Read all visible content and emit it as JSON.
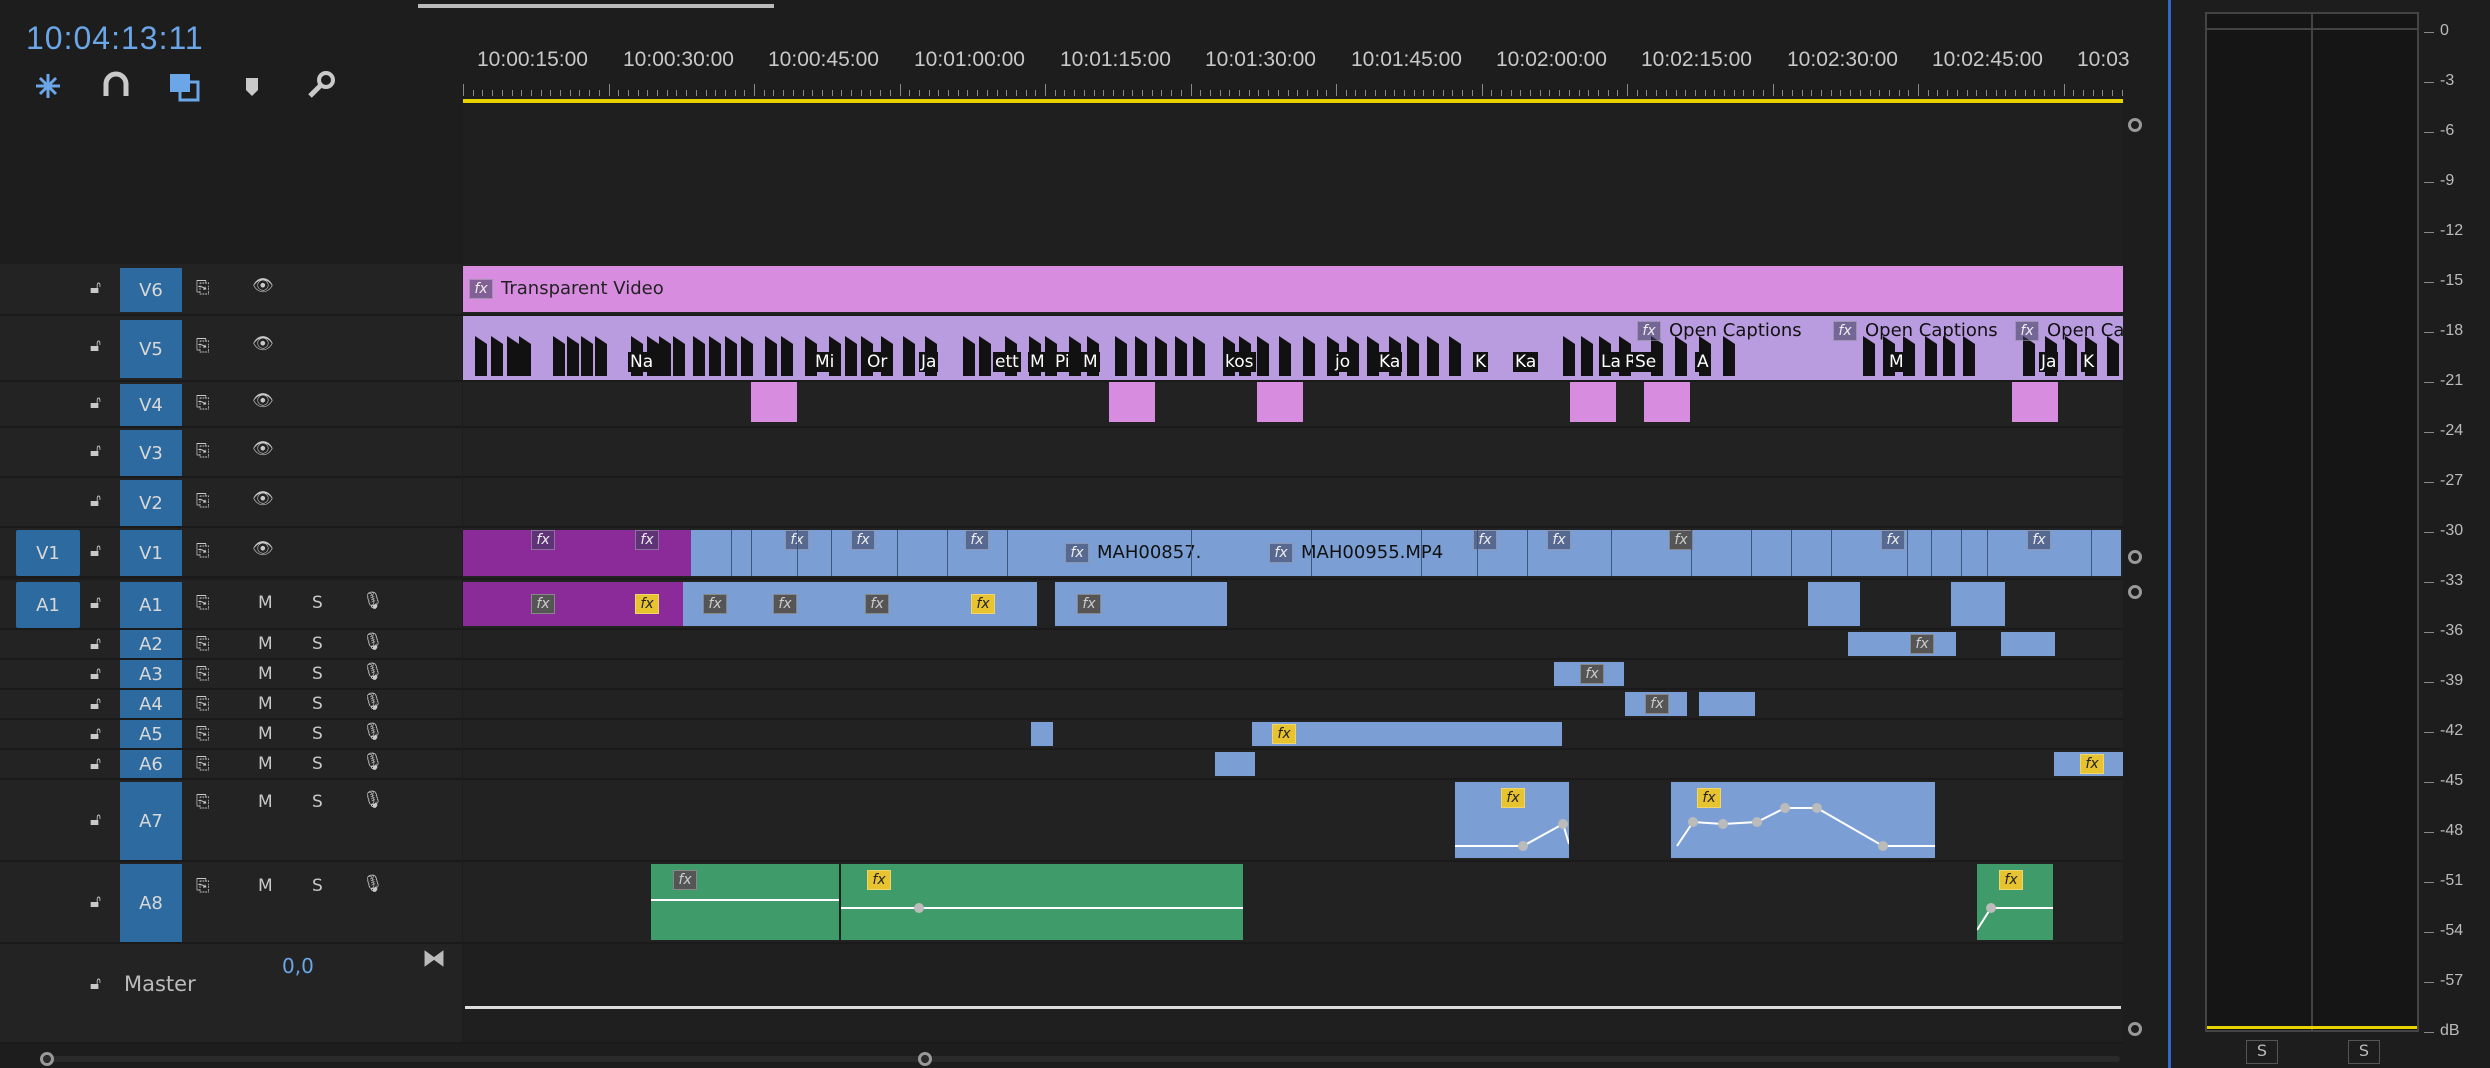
{
  "timecode": "10:04:13:11",
  "tools": [
    {
      "name": "snap-insert-icon"
    },
    {
      "name": "magnet-icon"
    },
    {
      "name": "linked-selection-icon"
    },
    {
      "name": "marker-icon"
    },
    {
      "name": "wrench-icon"
    }
  ],
  "ruler": {
    "labels": [
      "10:00:15:00",
      "10:00:30:00",
      "10:00:45:00",
      "10:01:00:00",
      "10:01:15:00",
      "10:01:30:00",
      "10:01:45:00",
      "10:02:00:00",
      "10:02:15:00",
      "10:02:30:00",
      "10:02:45:00",
      "10:03"
    ]
  },
  "video_tracks": [
    {
      "id": "V6",
      "label": "V6"
    },
    {
      "id": "V5",
      "label": "V5"
    },
    {
      "id": "V4",
      "label": "V4"
    },
    {
      "id": "V3",
      "label": "V3"
    },
    {
      "id": "V2",
      "label": "V2"
    },
    {
      "id": "V1",
      "label": "V1",
      "source": "V1"
    }
  ],
  "audio_tracks": [
    {
      "id": "A1",
      "label": "A1",
      "source": "A1",
      "m": "M",
      "s": "S"
    },
    {
      "id": "A2",
      "label": "A2",
      "m": "M",
      "s": "S"
    },
    {
      "id": "A3",
      "label": "A3",
      "m": "M",
      "s": "S"
    },
    {
      "id": "A4",
      "label": "A4",
      "m": "M",
      "s": "S"
    },
    {
      "id": "A5",
      "label": "A5",
      "m": "M",
      "s": "S"
    },
    {
      "id": "A6",
      "label": "A6",
      "m": "M",
      "s": "S"
    },
    {
      "id": "A7",
      "label": "A7",
      "m": "M",
      "s": "S"
    },
    {
      "id": "A8",
      "label": "A8",
      "m": "M",
      "s": "S"
    }
  ],
  "master": {
    "label": "Master",
    "value": "0,0"
  },
  "clips": {
    "transparent_video": "Transparent Video",
    "open_captions_1": "Open Captions",
    "open_captions_2": "Open Captions",
    "open_captions_3": "Open Ca",
    "v1_clip_a": "MAH00857.",
    "v1_clip_b": "MAH00955.MP4",
    "v5_labels": [
      "Na",
      "Mi",
      "Or",
      "Ja",
      "ett",
      "M",
      "Pi",
      "M",
      "kos",
      "jo",
      "Ka",
      "K",
      "Ka",
      "K",
      "La",
      "Ro",
      "A",
      "Se",
      "M",
      "Ja",
      "K"
    ],
    "fx": "fx"
  },
  "meter": {
    "db_labels": [
      "0",
      "-3",
      "-6",
      "-9",
      "-12",
      "-15",
      "-18",
      "-21",
      "-24",
      "-27",
      "-30",
      "-33",
      "-36",
      "-39",
      "-42",
      "-45",
      "-48",
      "-51",
      "-54",
      "-57",
      "dB"
    ],
    "solo_left": "S",
    "solo_right": "S"
  },
  "colors": {
    "accent": "#6aa6e8",
    "track_patch": "#2d6a9f",
    "clip_blue": "#7b9fd4",
    "clip_pink": "#d78ce0",
    "clip_purple": "#8b2b9a",
    "clip_green": "#3f9b6a",
    "playhead_bar": "#e8d200"
  }
}
